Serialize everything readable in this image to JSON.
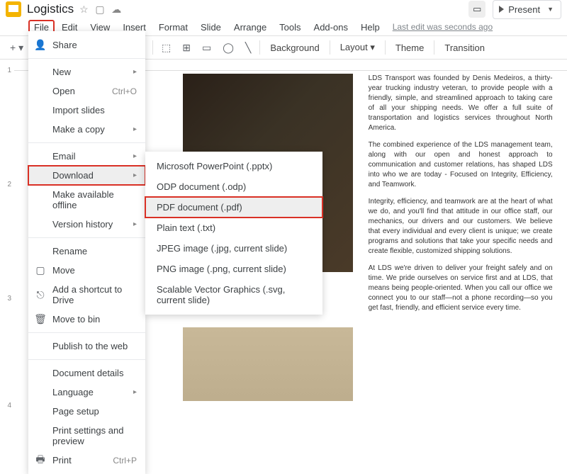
{
  "header": {
    "title": "Logistics",
    "last_edit": "Last edit was seconds ago",
    "present_label": "Present"
  },
  "menubar": {
    "file": "File",
    "edit": "Edit",
    "view": "View",
    "insert": "Insert",
    "format": "Format",
    "slide": "Slide",
    "arrange": "Arrange",
    "tools": "Tools",
    "addons": "Add-ons",
    "help": "Help"
  },
  "toolbar": {
    "background": "Background",
    "layout": "Layout",
    "theme": "Theme",
    "transition": "Transition"
  },
  "file_menu": {
    "share": "Share",
    "new": "New",
    "open": "Open",
    "open_shortcut": "Ctrl+O",
    "import_slides": "Import slides",
    "make_a_copy": "Make a copy",
    "email": "Email",
    "download": "Download",
    "make_available_offline": "Make available offline",
    "version_history": "Version history",
    "rename": "Rename",
    "move": "Move",
    "add_shortcut": "Add a shortcut to Drive",
    "move_to_bin": "Move to bin",
    "publish": "Publish to the web",
    "document_details": "Document details",
    "language": "Language",
    "page_setup": "Page setup",
    "print_settings": "Print settings and preview",
    "print": "Print",
    "print_shortcut": "Ctrl+P"
  },
  "download_submenu": {
    "pptx": "Microsoft PowerPoint (.pptx)",
    "odp": "ODP document (.odp)",
    "pdf": "PDF document (.pdf)",
    "txt": "Plain text (.txt)",
    "jpg": "JPEG image (.jpg, current slide)",
    "png": "PNG image (.png, current slide)",
    "svg": "Scalable Vector Graphics (.svg, current slide)"
  },
  "slide": {
    "p1": "LDS Transport was founded by Denis Medeiros, a thirty-year trucking industry veteran, to provide people with a friendly, simple, and streamlined approach to taking care of all your shipping needs. We offer a full suite of transportation and logistics services throughout North America.",
    "p2": "The combined experience of the LDS management team, along with our open and honest approach to communication and customer relations, has shaped LDS into who we are today - Focused on Integrity, Efficiency, and Teamwork.",
    "p3": "Integrity, efficiency, and teamwork  are at the heart of what we do, and  you'll find that attitude in our office staff, our mechanics, our drivers  and our customers. We believe that every individual and every client is unique; we create programs and solutions that take your specific needs and create flexible, customized shipping solutions.",
    "p4": "At LDS we're driven to deliver your freight safely and on time. We pride ourselves on service first and at LDS, that means being people-oriented. When you call our office we connect you to our staff—not a phone recording—so you get fast, friendly, and efficient service  every time."
  },
  "thumbs": {
    "n1": "1",
    "n2": "2",
    "n3": "3",
    "n4": "4"
  }
}
